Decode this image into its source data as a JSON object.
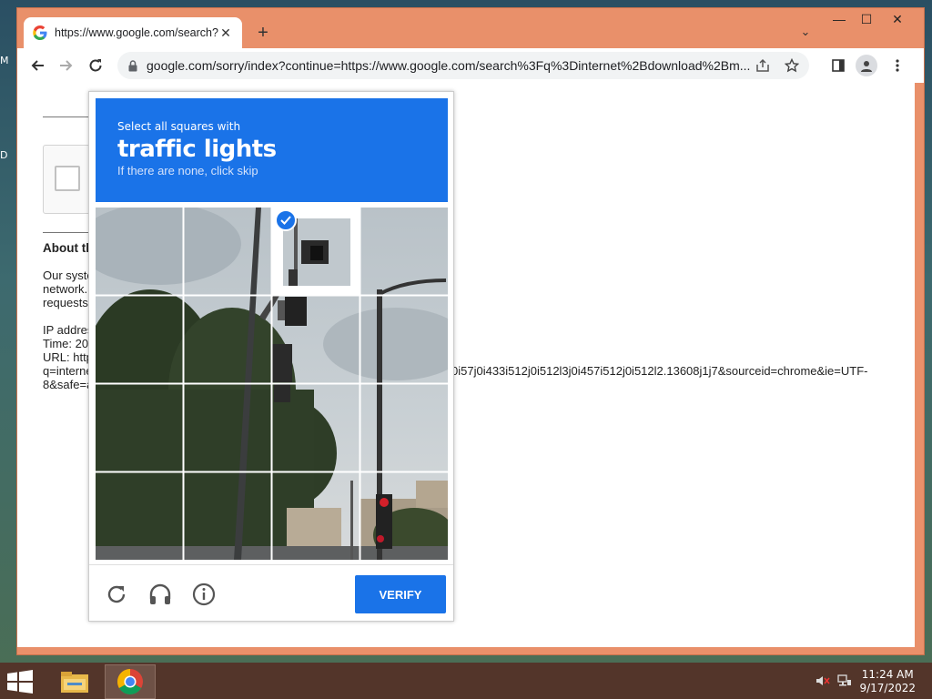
{
  "browser": {
    "tab_title": "https://www.google.com/search?",
    "close_tab": "✕",
    "new_tab": "+",
    "tab_search": "⌄",
    "url": "google.com/sorry/index?continue=https://www.google.com/search%3Fq%3Dinternet%2Bdownload%2Bm...",
    "window_minimize": "—",
    "window_maximize": "☐",
    "window_close": "✕"
  },
  "page": {
    "about_heading": "About th",
    "para1": [
      "Our syste",
      "network.",
      "requests"
    ],
    "ip_lines": [
      "IP addres",
      "Time: 20",
      "URL: http",
      "q=interne",
      "8&safe=a"
    ],
    "url_tail": "0i57j0i433i512j0i512l3j0i457i512j0i512l2.13608j1j7&sourceid=chrome&ie=UTF-"
  },
  "captcha": {
    "instruction_small": "Select all squares with",
    "instruction_target": "traffic lights",
    "instruction_sub": "If there are none, click skip",
    "selected_tiles": [
      2
    ],
    "verify_label": "VERIFY"
  },
  "taskbar": {
    "time": "11:24 AM",
    "date": "9/17/2022"
  },
  "desktop": {
    "icon_labels": [
      "M",
      "D"
    ]
  },
  "colors": {
    "accent": "#1a73e8",
    "window_frame": "#e9906a",
    "taskbar": "#53352a"
  }
}
